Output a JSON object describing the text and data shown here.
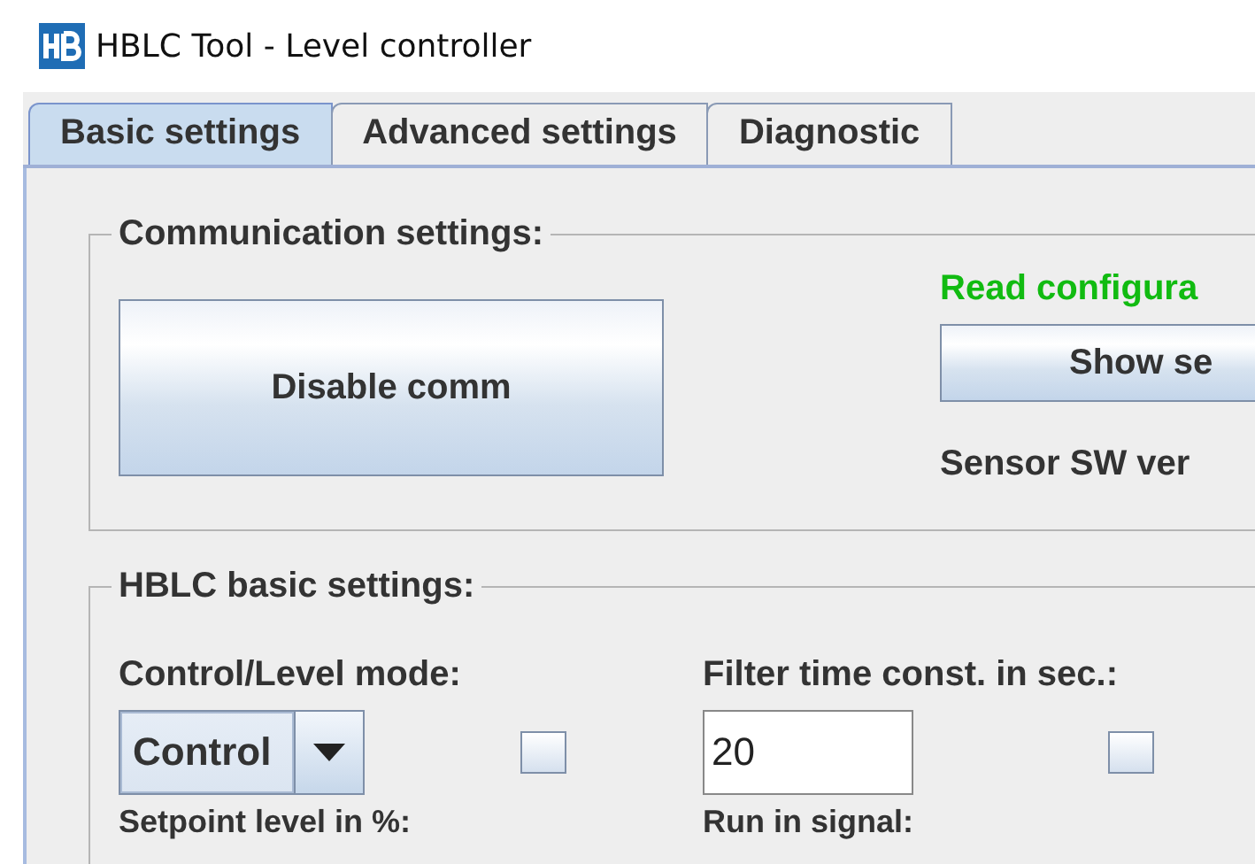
{
  "window": {
    "title": "HBLC Tool - Level controller"
  },
  "tabs": [
    {
      "label": "Basic settings",
      "selected": true
    },
    {
      "label": "Advanced settings",
      "selected": false
    },
    {
      "label": "Diagnostic",
      "selected": false
    }
  ],
  "communication": {
    "title": "Communication settings:",
    "button": "Disable comm",
    "status": "Read configura",
    "show_button": "Show se",
    "sensor_label": "Sensor SW ver"
  },
  "basic": {
    "title": "HBLC basic settings:",
    "mode_label": "Control/Level mode:",
    "mode_value": "Control",
    "mode_checked": false,
    "filter_label": "Filter time const. in sec.:",
    "filter_value": "20",
    "filter_checked": false,
    "setpoint_label": "Setpoint level in %:",
    "runin_label": "Run in signal:"
  }
}
